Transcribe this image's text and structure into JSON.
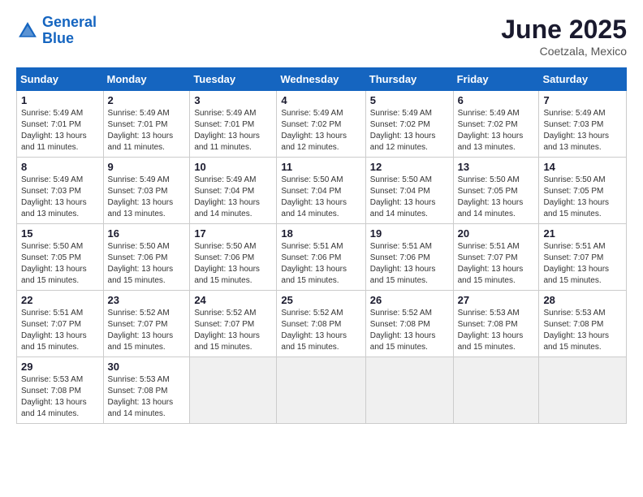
{
  "logo": {
    "line1": "General",
    "line2": "Blue"
  },
  "title": "June 2025",
  "subtitle": "Coetzala, Mexico",
  "weekdays": [
    "Sunday",
    "Monday",
    "Tuesday",
    "Wednesday",
    "Thursday",
    "Friday",
    "Saturday"
  ],
  "weeks": [
    [
      {
        "day": 1,
        "sunrise": "5:49 AM",
        "sunset": "7:01 PM",
        "daylight": "13 hours and 11 minutes."
      },
      {
        "day": 2,
        "sunrise": "5:49 AM",
        "sunset": "7:01 PM",
        "daylight": "13 hours and 11 minutes."
      },
      {
        "day": 3,
        "sunrise": "5:49 AM",
        "sunset": "7:01 PM",
        "daylight": "13 hours and 11 minutes."
      },
      {
        "day": 4,
        "sunrise": "5:49 AM",
        "sunset": "7:02 PM",
        "daylight": "13 hours and 12 minutes."
      },
      {
        "day": 5,
        "sunrise": "5:49 AM",
        "sunset": "7:02 PM",
        "daylight": "13 hours and 12 minutes."
      },
      {
        "day": 6,
        "sunrise": "5:49 AM",
        "sunset": "7:02 PM",
        "daylight": "13 hours and 13 minutes."
      },
      {
        "day": 7,
        "sunrise": "5:49 AM",
        "sunset": "7:03 PM",
        "daylight": "13 hours and 13 minutes."
      }
    ],
    [
      {
        "day": 8,
        "sunrise": "5:49 AM",
        "sunset": "7:03 PM",
        "daylight": "13 hours and 13 minutes."
      },
      {
        "day": 9,
        "sunrise": "5:49 AM",
        "sunset": "7:03 PM",
        "daylight": "13 hours and 13 minutes."
      },
      {
        "day": 10,
        "sunrise": "5:49 AM",
        "sunset": "7:04 PM",
        "daylight": "13 hours and 14 minutes."
      },
      {
        "day": 11,
        "sunrise": "5:50 AM",
        "sunset": "7:04 PM",
        "daylight": "13 hours and 14 minutes."
      },
      {
        "day": 12,
        "sunrise": "5:50 AM",
        "sunset": "7:04 PM",
        "daylight": "13 hours and 14 minutes."
      },
      {
        "day": 13,
        "sunrise": "5:50 AM",
        "sunset": "7:05 PM",
        "daylight": "13 hours and 14 minutes."
      },
      {
        "day": 14,
        "sunrise": "5:50 AM",
        "sunset": "7:05 PM",
        "daylight": "13 hours and 15 minutes."
      }
    ],
    [
      {
        "day": 15,
        "sunrise": "5:50 AM",
        "sunset": "7:05 PM",
        "daylight": "13 hours and 15 minutes."
      },
      {
        "day": 16,
        "sunrise": "5:50 AM",
        "sunset": "7:06 PM",
        "daylight": "13 hours and 15 minutes."
      },
      {
        "day": 17,
        "sunrise": "5:50 AM",
        "sunset": "7:06 PM",
        "daylight": "13 hours and 15 minutes."
      },
      {
        "day": 18,
        "sunrise": "5:51 AM",
        "sunset": "7:06 PM",
        "daylight": "13 hours and 15 minutes."
      },
      {
        "day": 19,
        "sunrise": "5:51 AM",
        "sunset": "7:06 PM",
        "daylight": "13 hours and 15 minutes."
      },
      {
        "day": 20,
        "sunrise": "5:51 AM",
        "sunset": "7:07 PM",
        "daylight": "13 hours and 15 minutes."
      },
      {
        "day": 21,
        "sunrise": "5:51 AM",
        "sunset": "7:07 PM",
        "daylight": "13 hours and 15 minutes."
      }
    ],
    [
      {
        "day": 22,
        "sunrise": "5:51 AM",
        "sunset": "7:07 PM",
        "daylight": "13 hours and 15 minutes."
      },
      {
        "day": 23,
        "sunrise": "5:52 AM",
        "sunset": "7:07 PM",
        "daylight": "13 hours and 15 minutes."
      },
      {
        "day": 24,
        "sunrise": "5:52 AM",
        "sunset": "7:07 PM",
        "daylight": "13 hours and 15 minutes."
      },
      {
        "day": 25,
        "sunrise": "5:52 AM",
        "sunset": "7:08 PM",
        "daylight": "13 hours and 15 minutes."
      },
      {
        "day": 26,
        "sunrise": "5:52 AM",
        "sunset": "7:08 PM",
        "daylight": "13 hours and 15 minutes."
      },
      {
        "day": 27,
        "sunrise": "5:53 AM",
        "sunset": "7:08 PM",
        "daylight": "13 hours and 15 minutes."
      },
      {
        "day": 28,
        "sunrise": "5:53 AM",
        "sunset": "7:08 PM",
        "daylight": "13 hours and 15 minutes."
      }
    ],
    [
      {
        "day": 29,
        "sunrise": "5:53 AM",
        "sunset": "7:08 PM",
        "daylight": "13 hours and 14 minutes."
      },
      {
        "day": 30,
        "sunrise": "5:53 AM",
        "sunset": "7:08 PM",
        "daylight": "13 hours and 14 minutes."
      },
      null,
      null,
      null,
      null,
      null
    ]
  ]
}
